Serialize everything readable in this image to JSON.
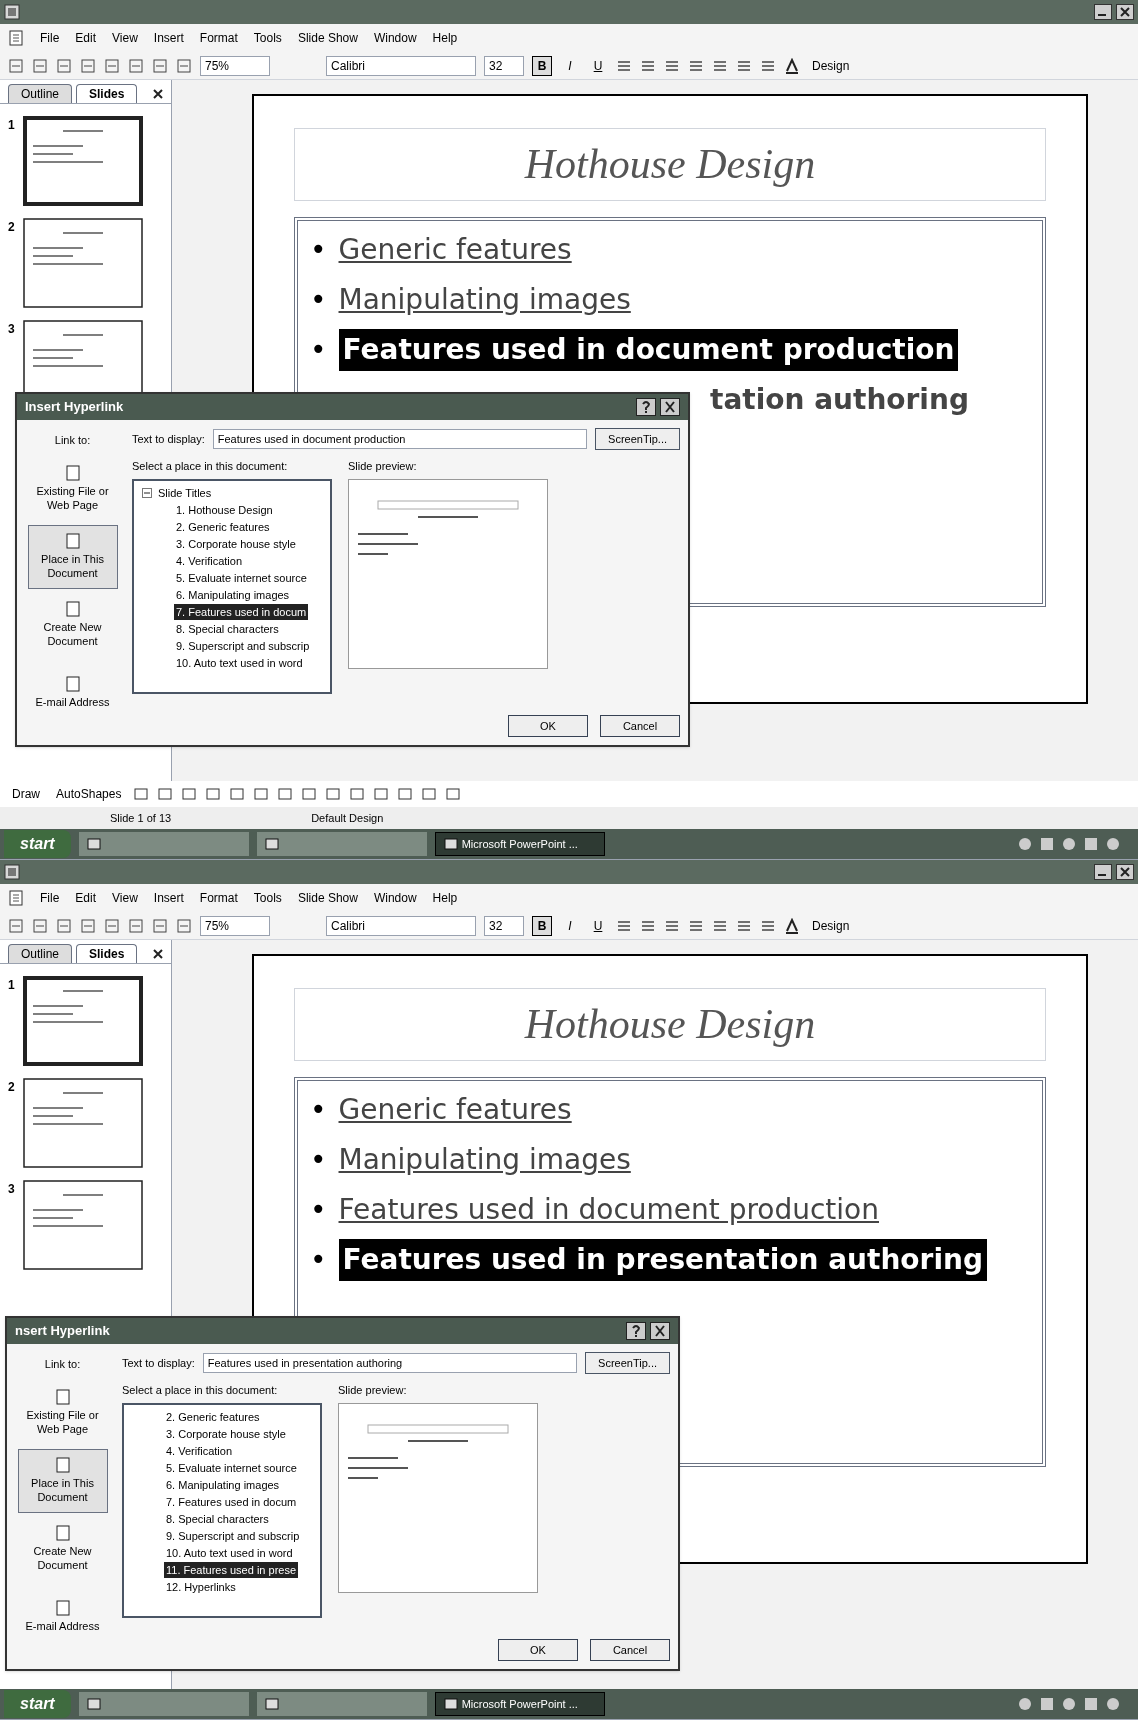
{
  "screens": [
    {
      "menu": [
        "File",
        "Edit",
        "View",
        "Insert",
        "Format",
        "Tools",
        "Slide Show",
        "Window",
        "Help"
      ],
      "toolbar": {
        "zoom": "75%",
        "font": "Calibri",
        "size": "32",
        "format_buttons": [
          {
            "label": "B",
            "on": true
          },
          {
            "label": "I",
            "on": false
          },
          {
            "label": "U",
            "on": false
          }
        ],
        "design": "Design"
      },
      "panel_tabs": [
        {
          "label": "Outline",
          "selected": false
        },
        {
          "label": "Slides",
          "selected": true
        }
      ],
      "thumbnails": [
        {
          "number": "1",
          "selected": true
        },
        {
          "number": "2",
          "selected": false
        },
        {
          "number": "3",
          "selected": false
        }
      ],
      "slide": {
        "title": "Hothouse Design",
        "bullets": [
          {
            "kind": "full",
            "bullet": "•",
            "text": "Generic features",
            "hyperlink": true,
            "selected": false
          },
          {
            "kind": "full",
            "bullet": "•",
            "text": "Manipulating images",
            "hyperlink": true,
            "selected": false
          },
          {
            "kind": "full",
            "bullet": "•",
            "text": "Features used in document production",
            "hyperlink": false,
            "selected": true
          },
          {
            "kind": "cut",
            "text": "tation authoring",
            "hyperlink": false,
            "selected": false
          }
        ]
      },
      "dialog": {
        "title": "Insert Hyperlink",
        "link_to": "Link to:",
        "link_options": [
          {
            "label": "Existing File or Web Page",
            "selected": false
          },
          {
            "label": "Place in This Document",
            "selected": true
          },
          {
            "label": "Create New Document",
            "selected": false
          },
          {
            "label": "E-mail Address",
            "selected": false
          }
        ],
        "text_label": "Text to display:",
        "text_value": "Features used in document production",
        "screentip": "ScreenTip...",
        "place_label": "Select a place in this document:",
        "preview_label": "Slide preview:",
        "tree": [
          {
            "label": "Slide Titles",
            "expanded": true,
            "selected": false,
            "children": [
              {
                "label": "1. Hothouse Design",
                "selected": false
              },
              {
                "label": "2. Generic features",
                "selected": false
              },
              {
                "label": "3. Corporate house style",
                "selected": false
              },
              {
                "label": "4. Verification",
                "selected": false
              },
              {
                "label": "5. Evaluate internet source",
                "selected": false
              },
              {
                "label": "6. Manipulating images",
                "selected": false
              },
              {
                "label": "7. Features used in docum",
                "selected": true
              },
              {
                "label": "8. Special characters",
                "selected": false
              },
              {
                "label": "9. Superscript and subscrip",
                "selected": false
              },
              {
                "label": "10. Auto text used in word",
                "selected": false
              }
            ]
          }
        ],
        "ok": "OK",
        "cancel": "Cancel"
      },
      "drawing_toolbar": {
        "draw": "Draw",
        "autoshapes": "AutoShapes"
      },
      "status_bar": [
        "Slide 1 of 13",
        "Default Design"
      ],
      "taskbar": {
        "start": "start",
        "tasks": [
          {
            "selected": false
          },
          {
            "selected": false
          },
          {
            "label": "Microsoft PowerPoint ...",
            "selected": true
          }
        ]
      }
    },
    {
      "menu": [
        "File",
        "Edit",
        "View",
        "Insert",
        "Format",
        "Tools",
        "Slide Show",
        "Window",
        "Help"
      ],
      "toolbar": {
        "zoom": "75%",
        "font": "Calibri",
        "size": "32",
        "format_buttons": [
          {
            "label": "B",
            "on": true
          },
          {
            "label": "I",
            "on": false
          },
          {
            "label": "U",
            "on": false
          }
        ],
        "design": "Design"
      },
      "panel_tabs": [
        {
          "label": "Outline",
          "selected": false
        },
        {
          "label": "Slides",
          "selected": true
        }
      ],
      "thumbnails": [
        {
          "number": "1",
          "selected": true
        },
        {
          "number": "2",
          "selected": false
        },
        {
          "number": "3",
          "selected": false
        }
      ],
      "slide": {
        "title": "Hothouse Design",
        "bullets": [
          {
            "kind": "full",
            "bullet": "•",
            "text": "Generic features",
            "hyperlink": true,
            "selected": false
          },
          {
            "kind": "full",
            "bullet": "•",
            "text": "Manipulating images",
            "hyperlink": true,
            "selected": false
          },
          {
            "kind": "full",
            "bullet": "•",
            "text": "Features used in document production",
            "hyperlink": true,
            "selected": false
          },
          {
            "kind": "full",
            "bullet": "•",
            "text": "Features used in presentation authoring",
            "hyperlink": false,
            "selected": true
          }
        ]
      },
      "dialog": {
        "title": "nsert Hyperlink",
        "link_to": "Link to:",
        "link_options": [
          {
            "label": "Existing File or Web Page",
            "selected": false
          },
          {
            "label": "Place in This Document",
            "selected": true
          },
          {
            "label": "Create New Document",
            "selected": false
          },
          {
            "label": "E-mail Address",
            "selected": false
          }
        ],
        "text_label": "Text to display:",
        "text_value": "Features used in presentation authoring",
        "screentip": "ScreenTip...",
        "place_label": "Select a place in this document:",
        "preview_label": "Slide preview:",
        "tree": [
          {
            "label": "2. Generic features",
            "selected": false
          },
          {
            "label": "3. Corporate house style",
            "selected": false
          },
          {
            "label": "4. Verification",
            "selected": false
          },
          {
            "label": "5. Evaluate internet source",
            "selected": false
          },
          {
            "label": "6. Manipulating images",
            "selected": false
          },
          {
            "label": "7. Features used in docum",
            "selected": false
          },
          {
            "label": "8. Special characters",
            "selected": false
          },
          {
            "label": "9. Superscript and subscrip",
            "selected": false
          },
          {
            "label": "10. Auto text used in word",
            "selected": false
          },
          {
            "label": "11. Features used in prese",
            "selected": true
          },
          {
            "label": "12. Hyperlinks",
            "selected": false
          }
        ],
        "ok": "OK",
        "cancel": "Cancel"
      },
      "taskbar": {
        "start": "start",
        "tasks": [
          {
            "selected": false
          },
          {
            "selected": false
          },
          {
            "label": "Microsoft PowerPoint ...",
            "selected": true
          }
        ]
      }
    }
  ]
}
